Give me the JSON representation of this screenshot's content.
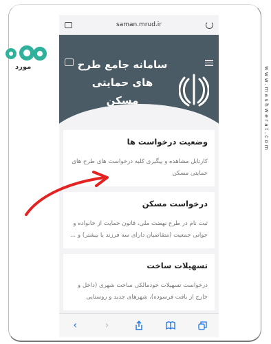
{
  "browser": {
    "url": "saman.mrud.ir"
  },
  "brand": {
    "name": "مورد"
  },
  "watermark": "www.mashwerat.com",
  "header": {
    "title": "سامانه جامع طرح های حمایتی مسکن"
  },
  "cards": [
    {
      "title": "وضعیت درخواست ها",
      "body": "کارتابل مشاهده و پیگیری کلیه درخواست های طرح های حمایتی مسکن"
    },
    {
      "title": "درخواست مسکن",
      "body": "ثبت نام در طرح نهضت ملی، قانون حمایت از خانواده و جوانی جمعیت (متقاضیان دارای سه فرزند یا بیشتر) و ..."
    },
    {
      "title": "تسهیلات ساخت",
      "body": "درخواست تسهیلات خودمالکی ساخت شهری (داخل و خارج از بافت فرسوده)، شهرهای جدید و روستایی"
    }
  ],
  "icons": {
    "back": "chevron-left-icon",
    "forward": "chevron-right-icon",
    "share": "share-icon",
    "bookmarks": "book-icon",
    "tabs": "tabs-icon"
  },
  "colors": {
    "header": "#4a5b65",
    "accent": "#1a73e8",
    "arrow": "#e32222",
    "brand": "#2fb19b"
  }
}
